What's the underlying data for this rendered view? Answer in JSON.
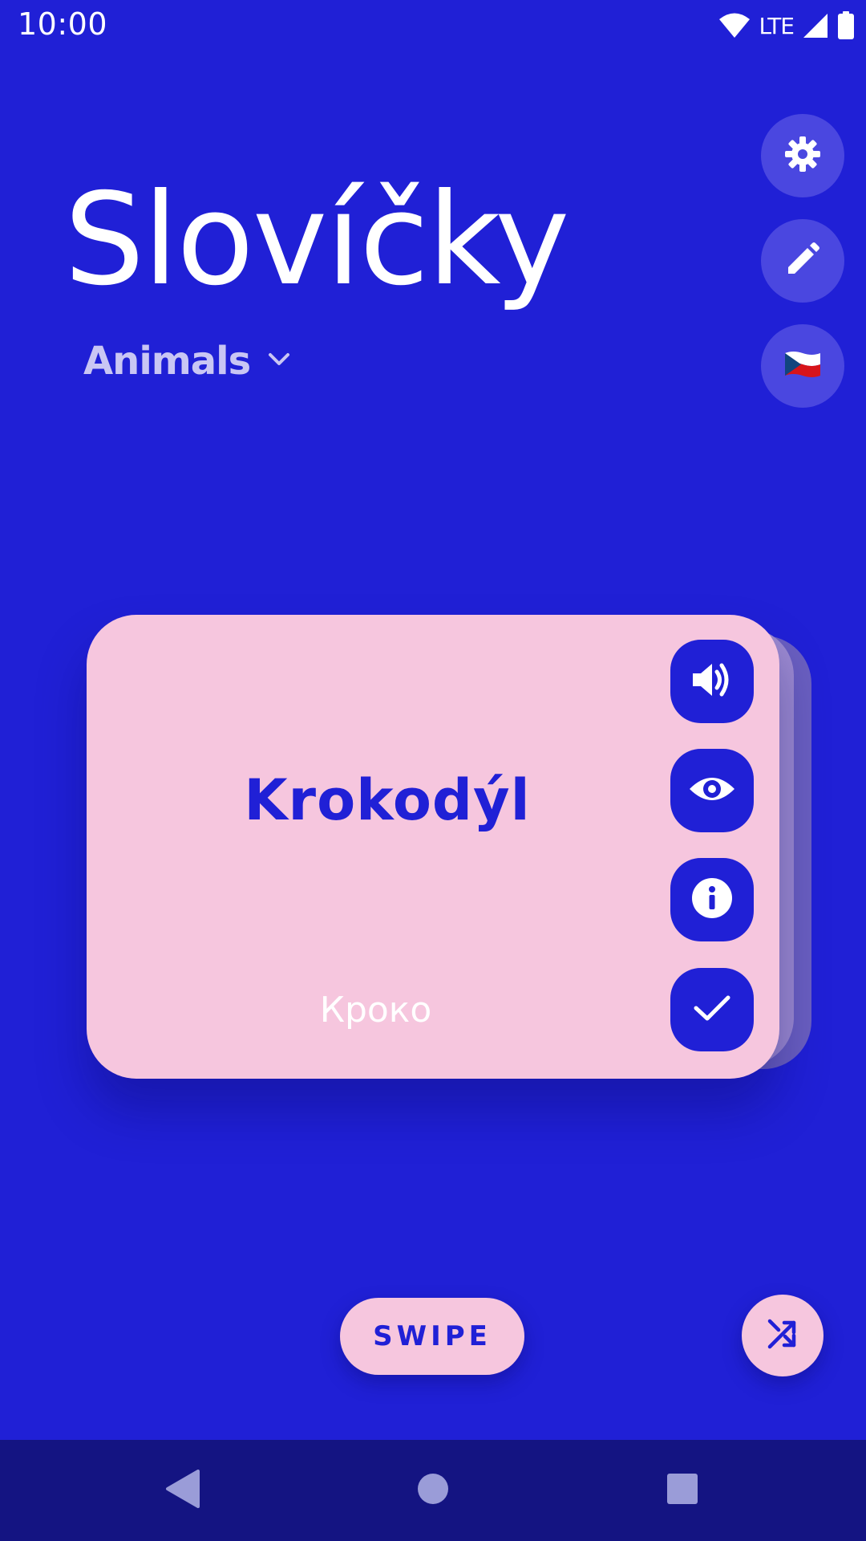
{
  "status_bar": {
    "time": "10:00",
    "network": "LTE",
    "icons": [
      "wifi-icon",
      "cell-signal-icon",
      "battery-icon"
    ]
  },
  "app": {
    "title": "Slovíčky",
    "category": "Animals"
  },
  "side_actions": [
    {
      "name": "settings",
      "icon": "gear-icon"
    },
    {
      "name": "edit",
      "icon": "pencil-icon"
    },
    {
      "name": "language",
      "icon": "czech-flag-icon"
    }
  ],
  "card": {
    "word": "Krokodýl",
    "answer_value": "Кроко",
    "actions": [
      {
        "name": "speak",
        "icon": "speaker-icon"
      },
      {
        "name": "reveal",
        "icon": "eye-icon"
      },
      {
        "name": "info",
        "icon": "info-icon"
      },
      {
        "name": "check",
        "icon": "checkmark-icon"
      }
    ]
  },
  "bottom": {
    "swipe_label": "SWIPE",
    "shuffle_icon": "shuffle-icon"
  },
  "nav": {
    "icons": [
      "back-icon",
      "home-icon",
      "recents-icon"
    ]
  },
  "colors": {
    "background": "#2020d6",
    "card": "#f6c6de",
    "nav_bar": "#141482",
    "side_button": "#4a47e0",
    "category_text": "#c9c6f4"
  }
}
